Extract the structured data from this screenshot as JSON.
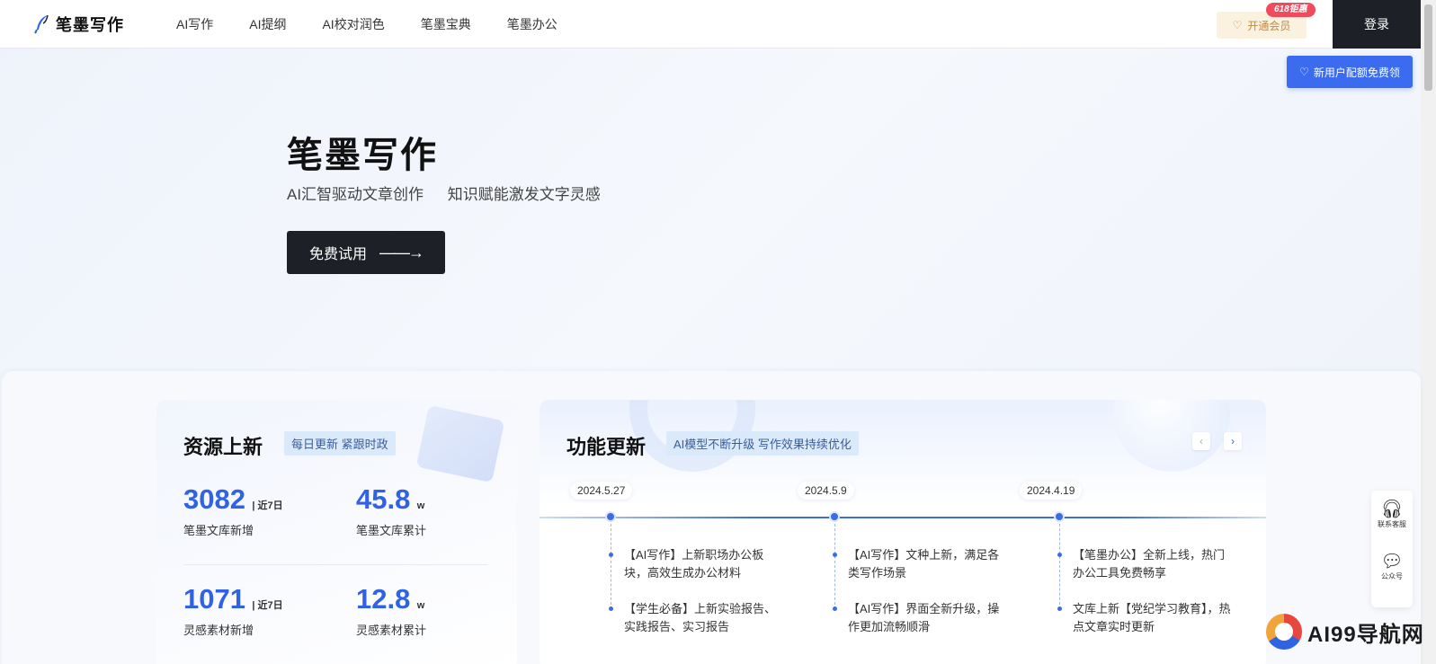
{
  "header": {
    "logo_text": "笔墨写作",
    "nav": [
      "AI写作",
      "AI提纲",
      "AI校对润色",
      "笔墨宝典",
      "笔墨办公"
    ],
    "vip_label": "开通会员",
    "promo_badge": "618钜惠",
    "login_label": "登录",
    "new_user_label": "新用户配额免费领"
  },
  "hero": {
    "title": "笔墨写作",
    "subtitle_1": "AI汇智驱动文章创作",
    "subtitle_2": "知识赋能激发文字灵感",
    "trial_label": "免费试用",
    "trial_arrow": "——→"
  },
  "resources": {
    "title": "资源上新",
    "tag": "每日更新 紧跟时政",
    "stats": [
      {
        "value": "3082",
        "unit": "| 近7日",
        "label": "笔墨文库新增"
      },
      {
        "value": "45.8",
        "unit": "w",
        "label": "笔墨文库累计"
      },
      {
        "value": "1071",
        "unit": "| 近7日",
        "label": "灵感素材新增"
      },
      {
        "value": "12.8",
        "unit": "w",
        "label": "灵感素材累计"
      }
    ]
  },
  "features": {
    "title": "功能更新",
    "tag": "AI模型不断升级 写作效果持续优化",
    "prev_label": "‹",
    "next_label": "›",
    "timeline": [
      {
        "date": "2024.5.27",
        "items": [
          "【AI写作】上新职场办公板块，高效生成办公材料",
          "【学生必备】上新实验报告、实践报告、实习报告"
        ]
      },
      {
        "date": "2024.5.9",
        "items": [
          "【AI写作】文种上新，满足各类写作场景",
          "【AI写作】界面全新升级，操作更加流畅顺滑"
        ]
      },
      {
        "date": "2024.4.19",
        "items": [
          "【笔墨办公】全新上线，热门办公工具免费畅享",
          "文库上新【党纪学习教育】，热点文章实时更新"
        ]
      }
    ]
  },
  "side_tools": {
    "service_label": "联系客服",
    "wechat_label": "公众号"
  },
  "watermark": {
    "text": "AI99导航网"
  },
  "colors": {
    "accent": "#3b6ce4",
    "dark_button": "#1d2127",
    "promo_red": "#f04a5d",
    "vip_gold": "#c58a3e"
  }
}
